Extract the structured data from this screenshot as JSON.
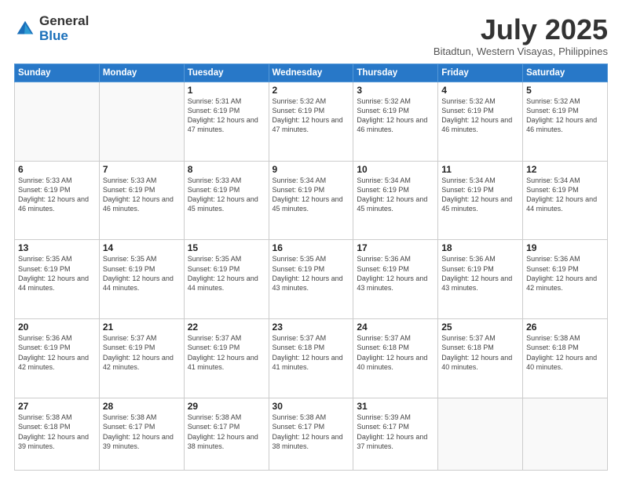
{
  "logo": {
    "general": "General",
    "blue": "Blue"
  },
  "title": {
    "month_year": "July 2025",
    "location": "Bitadtun, Western Visayas, Philippines"
  },
  "weekdays": [
    "Sunday",
    "Monday",
    "Tuesday",
    "Wednesday",
    "Thursday",
    "Friday",
    "Saturday"
  ],
  "weeks": [
    [
      {
        "day": "",
        "info": ""
      },
      {
        "day": "",
        "info": ""
      },
      {
        "day": "1",
        "info": "Sunrise: 5:31 AM\nSunset: 6:19 PM\nDaylight: 12 hours and 47 minutes."
      },
      {
        "day": "2",
        "info": "Sunrise: 5:32 AM\nSunset: 6:19 PM\nDaylight: 12 hours and 47 minutes."
      },
      {
        "day": "3",
        "info": "Sunrise: 5:32 AM\nSunset: 6:19 PM\nDaylight: 12 hours and 46 minutes."
      },
      {
        "day": "4",
        "info": "Sunrise: 5:32 AM\nSunset: 6:19 PM\nDaylight: 12 hours and 46 minutes."
      },
      {
        "day": "5",
        "info": "Sunrise: 5:32 AM\nSunset: 6:19 PM\nDaylight: 12 hours and 46 minutes."
      }
    ],
    [
      {
        "day": "6",
        "info": "Sunrise: 5:33 AM\nSunset: 6:19 PM\nDaylight: 12 hours and 46 minutes."
      },
      {
        "day": "7",
        "info": "Sunrise: 5:33 AM\nSunset: 6:19 PM\nDaylight: 12 hours and 46 minutes."
      },
      {
        "day": "8",
        "info": "Sunrise: 5:33 AM\nSunset: 6:19 PM\nDaylight: 12 hours and 45 minutes."
      },
      {
        "day": "9",
        "info": "Sunrise: 5:34 AM\nSunset: 6:19 PM\nDaylight: 12 hours and 45 minutes."
      },
      {
        "day": "10",
        "info": "Sunrise: 5:34 AM\nSunset: 6:19 PM\nDaylight: 12 hours and 45 minutes."
      },
      {
        "day": "11",
        "info": "Sunrise: 5:34 AM\nSunset: 6:19 PM\nDaylight: 12 hours and 45 minutes."
      },
      {
        "day": "12",
        "info": "Sunrise: 5:34 AM\nSunset: 6:19 PM\nDaylight: 12 hours and 44 minutes."
      }
    ],
    [
      {
        "day": "13",
        "info": "Sunrise: 5:35 AM\nSunset: 6:19 PM\nDaylight: 12 hours and 44 minutes."
      },
      {
        "day": "14",
        "info": "Sunrise: 5:35 AM\nSunset: 6:19 PM\nDaylight: 12 hours and 44 minutes."
      },
      {
        "day": "15",
        "info": "Sunrise: 5:35 AM\nSunset: 6:19 PM\nDaylight: 12 hours and 44 minutes."
      },
      {
        "day": "16",
        "info": "Sunrise: 5:35 AM\nSunset: 6:19 PM\nDaylight: 12 hours and 43 minutes."
      },
      {
        "day": "17",
        "info": "Sunrise: 5:36 AM\nSunset: 6:19 PM\nDaylight: 12 hours and 43 minutes."
      },
      {
        "day": "18",
        "info": "Sunrise: 5:36 AM\nSunset: 6:19 PM\nDaylight: 12 hours and 43 minutes."
      },
      {
        "day": "19",
        "info": "Sunrise: 5:36 AM\nSunset: 6:19 PM\nDaylight: 12 hours and 42 minutes."
      }
    ],
    [
      {
        "day": "20",
        "info": "Sunrise: 5:36 AM\nSunset: 6:19 PM\nDaylight: 12 hours and 42 minutes."
      },
      {
        "day": "21",
        "info": "Sunrise: 5:37 AM\nSunset: 6:19 PM\nDaylight: 12 hours and 42 minutes."
      },
      {
        "day": "22",
        "info": "Sunrise: 5:37 AM\nSunset: 6:19 PM\nDaylight: 12 hours and 41 minutes."
      },
      {
        "day": "23",
        "info": "Sunrise: 5:37 AM\nSunset: 6:18 PM\nDaylight: 12 hours and 41 minutes."
      },
      {
        "day": "24",
        "info": "Sunrise: 5:37 AM\nSunset: 6:18 PM\nDaylight: 12 hours and 40 minutes."
      },
      {
        "day": "25",
        "info": "Sunrise: 5:37 AM\nSunset: 6:18 PM\nDaylight: 12 hours and 40 minutes."
      },
      {
        "day": "26",
        "info": "Sunrise: 5:38 AM\nSunset: 6:18 PM\nDaylight: 12 hours and 40 minutes."
      }
    ],
    [
      {
        "day": "27",
        "info": "Sunrise: 5:38 AM\nSunset: 6:18 PM\nDaylight: 12 hours and 39 minutes."
      },
      {
        "day": "28",
        "info": "Sunrise: 5:38 AM\nSunset: 6:17 PM\nDaylight: 12 hours and 39 minutes."
      },
      {
        "day": "29",
        "info": "Sunrise: 5:38 AM\nSunset: 6:17 PM\nDaylight: 12 hours and 38 minutes."
      },
      {
        "day": "30",
        "info": "Sunrise: 5:38 AM\nSunset: 6:17 PM\nDaylight: 12 hours and 38 minutes."
      },
      {
        "day": "31",
        "info": "Sunrise: 5:39 AM\nSunset: 6:17 PM\nDaylight: 12 hours and 37 minutes."
      },
      {
        "day": "",
        "info": ""
      },
      {
        "day": "",
        "info": ""
      }
    ]
  ]
}
